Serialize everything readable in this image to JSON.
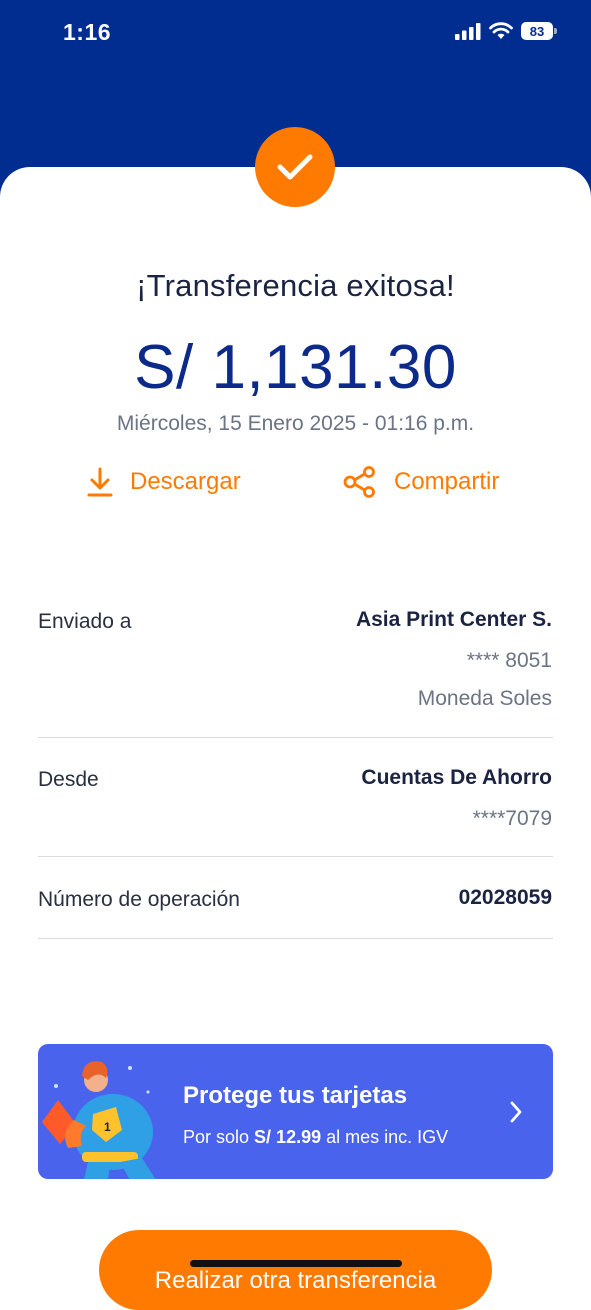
{
  "status_bar": {
    "time": "1:16",
    "battery": "83"
  },
  "receipt": {
    "title": "¡Transferencia exitosa!",
    "amount": "S/ 1,131.30",
    "datetime": "Miércoles, 15 Enero 2025 - 01:16 p.m."
  },
  "actions": {
    "download_label": "Descargar",
    "share_label": "Compartir"
  },
  "details": {
    "sent_to": {
      "label": "Enviado a",
      "name": "Asia Print Center S.",
      "account": "**** 8051",
      "currency": "Moneda Soles"
    },
    "from": {
      "label": "Desde",
      "account_type": "Cuentas De Ahorro",
      "account": "****7079"
    },
    "operation": {
      "label": "Número de operación",
      "number": "02028059"
    }
  },
  "promo": {
    "title": "Protege tus tarjetas",
    "subtitle_prefix": "Por solo ",
    "price": "S/ 12.99",
    "subtitle_suffix": " al mes inc. IGV"
  },
  "cta": {
    "label": "Realizar otra transferencia"
  },
  "colors": {
    "header_blue": "#002d8f",
    "accent_orange": "#ff7a00",
    "promo_blue": "#4a63ec",
    "amount_blue": "#0b2a8a"
  },
  "icons": [
    "check-icon",
    "download-icon",
    "share-icon",
    "chevron-right-icon",
    "signal-icon",
    "wifi-icon",
    "battery-icon"
  ]
}
